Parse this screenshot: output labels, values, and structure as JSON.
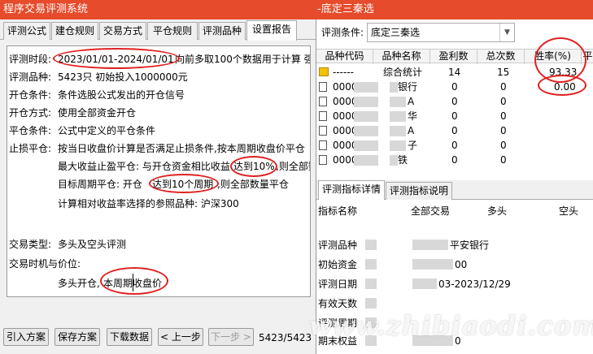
{
  "left_window": {
    "title": "程序交易评测系统",
    "tabs": [
      "评测公式",
      "建仓规则",
      "交易方式",
      "平仓规则",
      "评测品种",
      "设置报告"
    ],
    "active_tab": "设置报告",
    "report": {
      "period_label": "评测时段:",
      "period_value": "2023/01/01-2024/01/01",
      "period_note": "向前多取100个数据用于计算 强",
      "variety_label": "评测品种:",
      "variety_value": "5423只  初始投入1000000元",
      "open_cond_label": "开仓条件:",
      "open_cond_value": "条件选股公式发出的开仓信号",
      "open_mode_label": "开仓方式:",
      "open_mode_value": "使用全部资金开仓",
      "close_cond_label": "平仓条件:",
      "close_cond_value": "公式中定义的平仓条件",
      "stoploss_label": "止损平仓:",
      "stoploss_value": "按当日收盘价计算是否满足止损条件,按本周期收盘价平仓",
      "max_profit_prefix": "最大收益止盈平仓: 与开仓资金相比收益",
      "max_profit_circled": "达到10%",
      "max_profit_suffix": ",则全部数",
      "target_prefix": "目标周期平仓: 开仓",
      "target_circled": "达到10个周期",
      "target_suffix": ",则全部数量平仓",
      "benchmark_value": "计算相对收益率选择的参照品种: 沪深300",
      "trade_type_label": "交易类型:",
      "trade_type_value": "多头及空头评测",
      "timing_label": "交易时机与价位:",
      "timing_prefix": "多头开仓,",
      "timing_circled": "本周期收盘价"
    },
    "buttons": {
      "import": "引入方案",
      "save": "保存方案",
      "download": "下载数据",
      "prev": "< 上一步",
      "next": "下一步 >",
      "progress": "5423/5423"
    }
  },
  "right_window": {
    "title": "-底定三秦选",
    "condition_label": "评测条件:",
    "condition_value": "底定三秦选",
    "columns": [
      "品种代码",
      "品种名称",
      "盈利数",
      "总次数",
      "胜率(%)",
      "平"
    ],
    "summary_row": {
      "code": "------",
      "name": "综合统计",
      "profit": "14",
      "total": "15",
      "winrate": "93.33"
    },
    "rows": [
      {
        "code": "0000",
        "name": "银行",
        "profit": "0",
        "total": "0",
        "winrate": "0.00"
      },
      {
        "code": "0000",
        "name": "A",
        "profit": "0",
        "total": "0",
        "winrate": ""
      },
      {
        "code": "0000",
        "name": "华",
        "profit": "0",
        "total": "0",
        "winrate": ""
      },
      {
        "code": "0000",
        "name": "A",
        "profit": "0",
        "total": "0",
        "winrate": ""
      },
      {
        "code": "0000",
        "name": "子",
        "profit": "0",
        "total": "0",
        "winrate": ""
      },
      {
        "code": "0000",
        "name": "铁",
        "profit": "0",
        "total": "0",
        "winrate": ""
      }
    ],
    "detail_tabs": [
      "评测指标详情",
      "评测指标说明"
    ],
    "detail_columns": [
      "指标名称",
      "全部交易",
      "多头",
      "空头"
    ],
    "detail_rows": [
      {
        "label": "评测品种",
        "value": "平安银行"
      },
      {
        "label": "初始资金",
        "value": "00"
      },
      {
        "label": "评测日期",
        "value": "03-2023/12/29"
      },
      {
        "label": "有效天数",
        "value": ""
      },
      {
        "label": "评测周期",
        "value": ""
      },
      {
        "label": "期末权益",
        "value": "0"
      }
    ],
    "watermark": "www.zhibiaodi.com"
  },
  "colors": {
    "title_bar": "#e64b2b",
    "annotation": "#e02020"
  }
}
